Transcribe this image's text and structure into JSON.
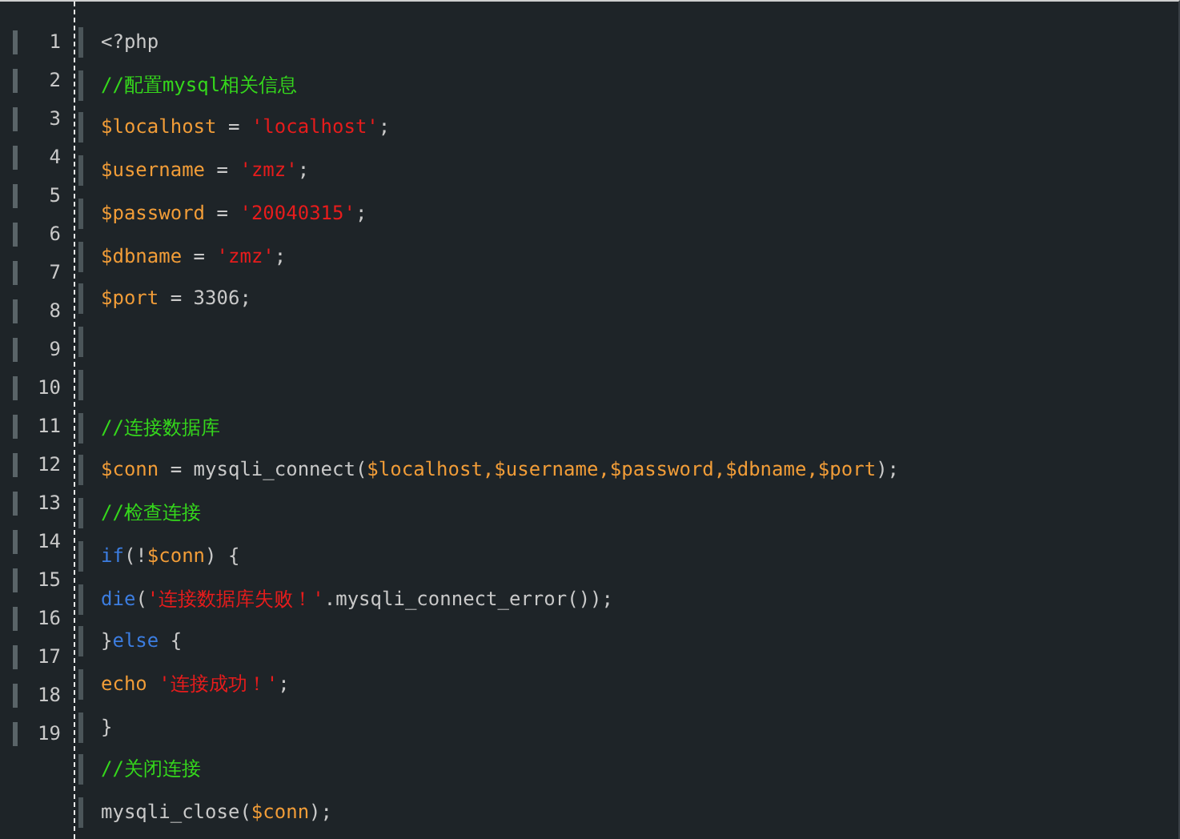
{
  "gutter": {
    "line_numbers": [
      "1",
      "2",
      "3",
      "4",
      "5",
      "6",
      "7",
      "8",
      "9",
      "10",
      "11",
      "12",
      "13",
      "14",
      "15",
      "16",
      "17",
      "18",
      "19"
    ]
  },
  "code_lines": [
    {
      "kind": "code",
      "tokens": [
        {
          "text": "<?php",
          "kind": "plain"
        }
      ]
    },
    {
      "kind": "code",
      "tokens": [
        {
          "text": "//配置mysql相关信息",
          "kind": "comment"
        }
      ]
    },
    {
      "kind": "code",
      "tokens": [
        {
          "text": "$localhost",
          "kind": "var"
        },
        {
          "text": " = ",
          "kind": "plain"
        },
        {
          "text": "'localhost'",
          "kind": "string"
        },
        {
          "text": ";",
          "kind": "plain"
        }
      ]
    },
    {
      "kind": "code",
      "tokens": [
        {
          "text": "$username",
          "kind": "var"
        },
        {
          "text": " = ",
          "kind": "plain"
        },
        {
          "text": "'zmz'",
          "kind": "string"
        },
        {
          "text": ";",
          "kind": "plain"
        }
      ]
    },
    {
      "kind": "code",
      "tokens": [
        {
          "text": "$password",
          "kind": "var"
        },
        {
          "text": " = ",
          "kind": "plain"
        },
        {
          "text": "'20040315'",
          "kind": "string"
        },
        {
          "text": ";",
          "kind": "plain"
        }
      ]
    },
    {
      "kind": "code",
      "tokens": [
        {
          "text": "$dbname",
          "kind": "var"
        },
        {
          "text": " = ",
          "kind": "plain"
        },
        {
          "text": "'zmz'",
          "kind": "string"
        },
        {
          "text": ";",
          "kind": "plain"
        }
      ]
    },
    {
      "kind": "code",
      "tokens": [
        {
          "text": "$port",
          "kind": "var"
        },
        {
          "text": " = 3306;",
          "kind": "plain"
        }
      ]
    },
    {
      "kind": "blank"
    },
    {
      "kind": "blank"
    },
    {
      "kind": "code",
      "tokens": [
        {
          "text": "//连接数据库",
          "kind": "comment"
        }
      ]
    },
    {
      "kind": "code",
      "tokens": [
        {
          "text": "$conn",
          "kind": "var"
        },
        {
          "text": " = mysqli_connect(",
          "kind": "plain"
        },
        {
          "text": "$localhost,$username,$password,$dbname,$port",
          "kind": "var"
        },
        {
          "text": ");",
          "kind": "plain"
        }
      ]
    },
    {
      "kind": "code",
      "tokens": [
        {
          "text": "//检查连接",
          "kind": "comment"
        }
      ]
    },
    {
      "kind": "code",
      "tokens": [
        {
          "text": "if",
          "kind": "keyword"
        },
        {
          "text": "(!",
          "kind": "plain"
        },
        {
          "text": "$conn",
          "kind": "var"
        },
        {
          "text": ") {",
          "kind": "plain"
        }
      ]
    },
    {
      "kind": "code",
      "tokens": [
        {
          "text": "die",
          "kind": "keyword"
        },
        {
          "text": "(",
          "kind": "plain"
        },
        {
          "text": "'连接数据库失败！'",
          "kind": "string"
        },
        {
          "text": ".mysqli_connect_error());",
          "kind": "plain"
        }
      ]
    },
    {
      "kind": "code",
      "tokens": [
        {
          "text": "}",
          "kind": "plain"
        },
        {
          "text": "else",
          "kind": "keyword"
        },
        {
          "text": " {",
          "kind": "plain"
        }
      ]
    },
    {
      "kind": "code",
      "tokens": [
        {
          "text": "echo ",
          "kind": "var"
        },
        {
          "text": "'连接成功！'",
          "kind": "string"
        },
        {
          "text": ";",
          "kind": "plain"
        }
      ]
    },
    {
      "kind": "code",
      "tokens": [
        {
          "text": "}",
          "kind": "plain"
        }
      ]
    },
    {
      "kind": "code",
      "tokens": [
        {
          "text": "//关闭连接",
          "kind": "comment"
        }
      ]
    },
    {
      "kind": "code",
      "tokens": [
        {
          "text": "mysqli_close(",
          "kind": "plain"
        },
        {
          "text": "$conn",
          "kind": "var"
        },
        {
          "text": ");",
          "kind": "plain"
        }
      ]
    }
  ]
}
